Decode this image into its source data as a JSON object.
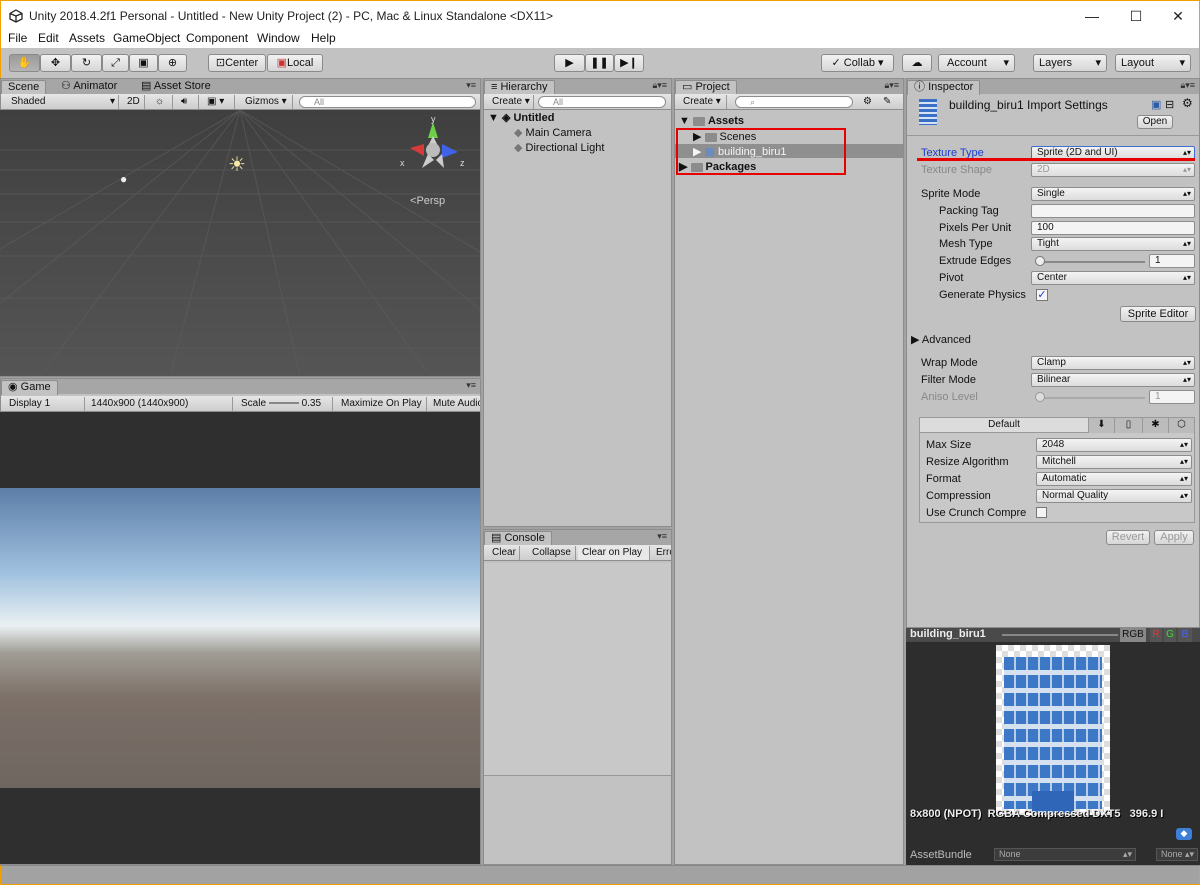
{
  "window": {
    "title": "Unity 2018.4.2f1 Personal - Untitled - New Unity Project (2) - PC, Mac & Linux Standalone <DX11>",
    "minimize": "—",
    "maximize": "☐",
    "close": "✕"
  },
  "menu": [
    "File",
    "Edit",
    "Assets",
    "GameObject",
    "Component",
    "Window",
    "Help"
  ],
  "toolbar": {
    "center": "Center",
    "local": "Local",
    "collab": "Collab",
    "account": "Account",
    "layers": "Layers",
    "layout": "Layout"
  },
  "scene": {
    "tabs": [
      "Scene",
      "Animator",
      "Asset Store"
    ],
    "shading": "Shaded",
    "mode2d": "2D",
    "gizmos": "Gizmos",
    "search_placeholder": "All",
    "persp": "Persp",
    "axis_x": "x",
    "axis_y": "y",
    "axis_z": "z"
  },
  "game": {
    "tab": "Game",
    "display": "Display 1",
    "resolution": "1440x900 (1440x900)",
    "scale_label": "Scale",
    "scale_value": "0.35",
    "maximize": "Maximize On Play",
    "mute": "Mute Audio"
  },
  "hierarchy": {
    "tab": "Hierarchy",
    "create": "Create",
    "search_placeholder": "All",
    "scene_name": "Untitled",
    "items": [
      "Main Camera",
      "Directional Light"
    ]
  },
  "console": {
    "tab": "Console",
    "buttons": [
      "Clear",
      "Collapse",
      "Clear on Play",
      "Error"
    ]
  },
  "project": {
    "tab": "Project",
    "create": "Create",
    "assets": "Assets",
    "scenes": "Scenes",
    "asset_file": "building_biru1",
    "packages": "Packages"
  },
  "inspector": {
    "tab": "Inspector",
    "title": "building_biru1 Import Settings",
    "open": "Open",
    "texture_type_label": "Texture Type",
    "texture_type_value": "Sprite (2D and UI)",
    "texture_shape_label": "Texture Shape",
    "texture_shape_value": "2D",
    "sprite_mode_label": "Sprite Mode",
    "sprite_mode_value": "Single",
    "packing_tag_label": "Packing Tag",
    "packing_tag_value": "",
    "ppu_label": "Pixels Per Unit",
    "ppu_value": "100",
    "mesh_type_label": "Mesh Type",
    "mesh_type_value": "Tight",
    "extrude_label": "Extrude Edges",
    "extrude_value": "1",
    "pivot_label": "Pivot",
    "pivot_value": "Center",
    "gen_physics_label": "Generate Physics",
    "gen_physics_checked": true,
    "sprite_editor": "Sprite Editor",
    "advanced": "Advanced",
    "wrap_label": "Wrap Mode",
    "wrap_value": "Clamp",
    "filter_label": "Filter Mode",
    "filter_value": "Bilinear",
    "aniso_label": "Aniso Level",
    "aniso_value": "1",
    "platform_default": "Default",
    "max_size_label": "Max Size",
    "max_size_value": "2048",
    "resize_label": "Resize Algorithm",
    "resize_value": "Mitchell",
    "format_label": "Format",
    "format_value": "Automatic",
    "compression_label": "Compression",
    "compression_value": "Normal Quality",
    "crunch_label": "Use Crunch Compre",
    "revert": "Revert",
    "apply": "Apply"
  },
  "preview": {
    "name": "building_biru1",
    "rgb": "RGB",
    "r": "R",
    "g": "G",
    "b": "B",
    "info_size": "8x800 (NPOT)",
    "info_format": "RGBA Compressed DXT5",
    "info_mem": "396.9 I",
    "assetbundle_label": "AssetBundle",
    "assetbundle_value": "None",
    "assetbundle_variant": "None"
  },
  "colors": {
    "highlight_red": "#e60000",
    "blue_label": "#1a3ed0"
  }
}
